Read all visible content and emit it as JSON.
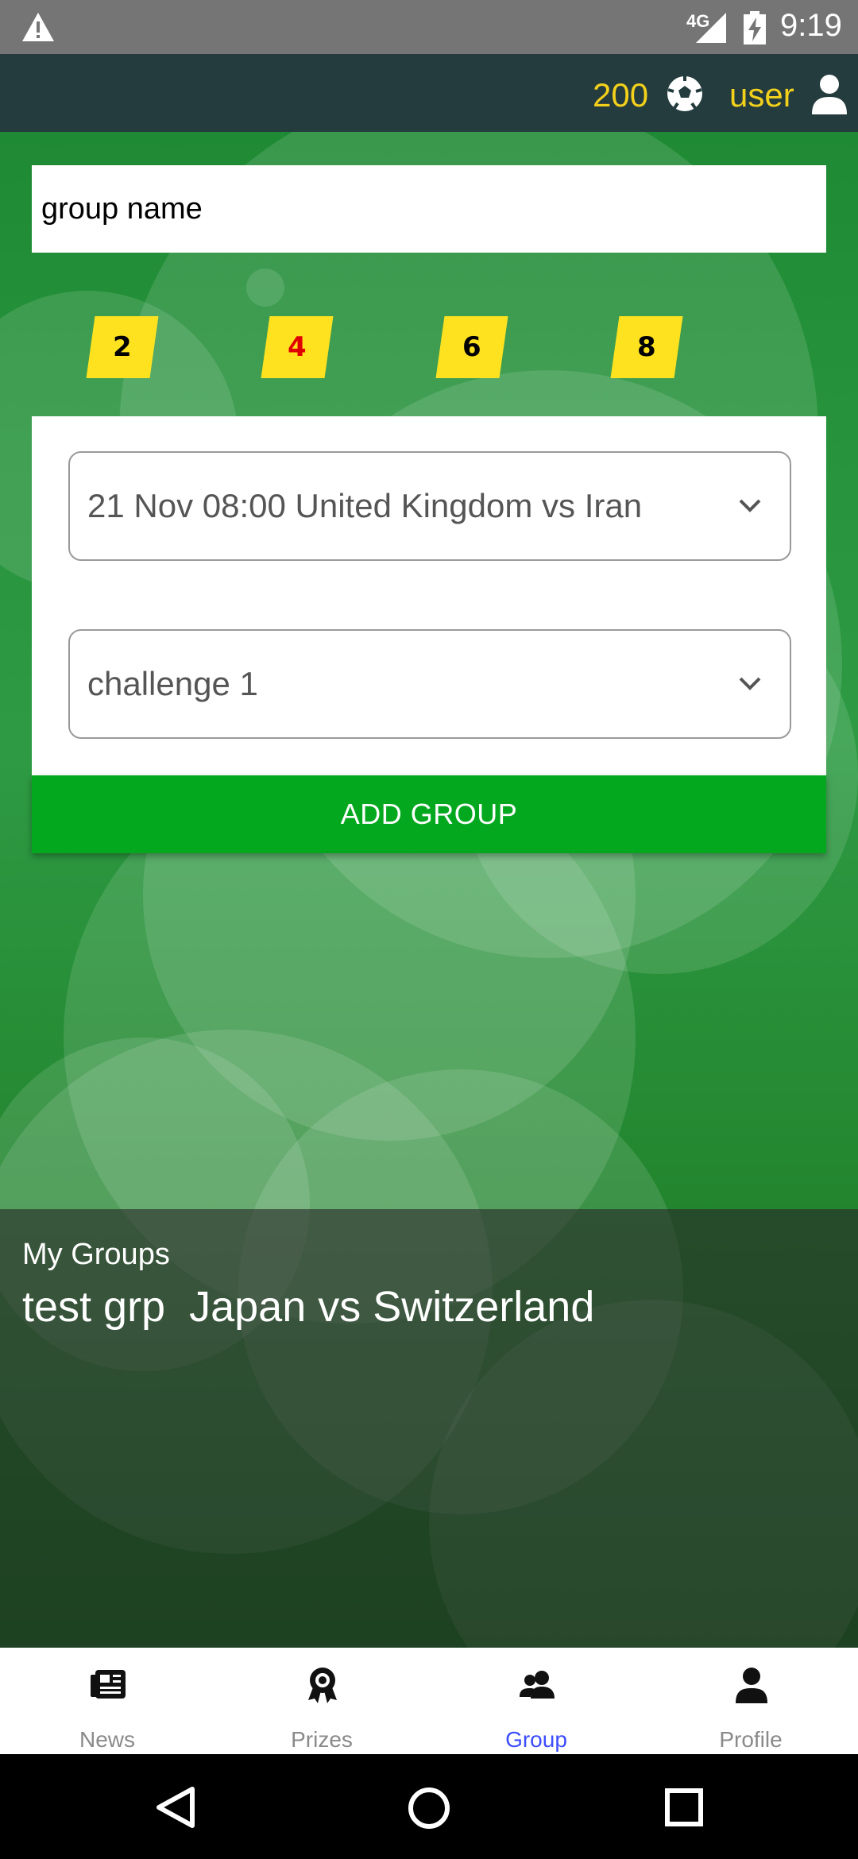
{
  "status_bar": {
    "network": "4G",
    "time": "9:19",
    "icons": [
      "warning-icon",
      "signal-icon",
      "battery-charging-icon"
    ]
  },
  "top_bar": {
    "coins": "200",
    "coin_icon": "soccer-ball-icon",
    "username": "user",
    "user_icon": "person-icon",
    "accent_color": "#f3d11b",
    "bg_color": "#243c3e"
  },
  "form": {
    "group_name_placeholder": "group name",
    "group_sizes": [
      "2",
      "4",
      "6",
      "8"
    ],
    "selected_size": "4",
    "match_select": "21 Nov 08:00 United Kingdom vs Iran",
    "challenge_select": "challenge 1",
    "add_button": "ADD GROUP",
    "button_color": "#04a81f"
  },
  "my_groups": {
    "heading": "My Groups",
    "items": [
      {
        "name": "test grp",
        "match": "Japan vs Switzerland",
        "text": "test grp  Japan vs Switzerland"
      }
    ]
  },
  "bottom_nav": {
    "items": [
      {
        "label": "News",
        "icon": "newspaper-icon"
      },
      {
        "label": "Prizes",
        "icon": "award-icon"
      },
      {
        "label": "Group",
        "icon": "users-icon",
        "active": true
      },
      {
        "label": "Profile",
        "icon": "person-icon"
      }
    ],
    "active_color": "#3d4dff"
  },
  "system_nav": [
    "back-icon",
    "home-icon",
    "recents-icon"
  ]
}
